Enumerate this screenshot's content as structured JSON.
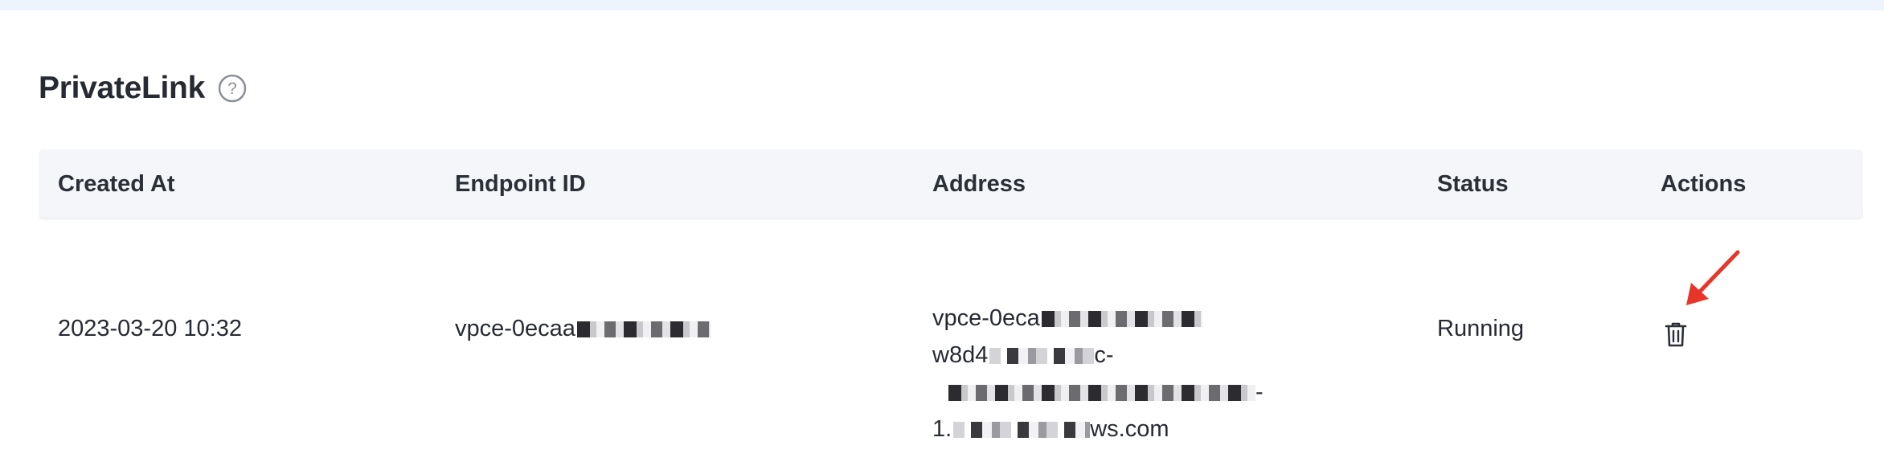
{
  "page": {
    "title": "PrivateLink"
  },
  "table": {
    "columns": [
      "Created At",
      "Endpoint ID",
      "Address",
      "Status",
      "Actions"
    ],
    "rows": [
      {
        "created_at": "2023-03-20 10:32",
        "endpoint_id": "vpce-0ecaa",
        "address_lines": [
          "vpce-0eca",
          "w8d4",
          "c-",
          "1.",
          "ws.com"
        ],
        "status": "Running"
      }
    ]
  },
  "icons": {
    "help": "question-circle-icon",
    "delete": "trash-icon",
    "annotation": "red-arrow-annotation"
  },
  "colors": {
    "header_bg": "#f5f6f9",
    "top_strip": "#eef4fb",
    "text": "#262a33",
    "arrow": "#e8352a"
  }
}
